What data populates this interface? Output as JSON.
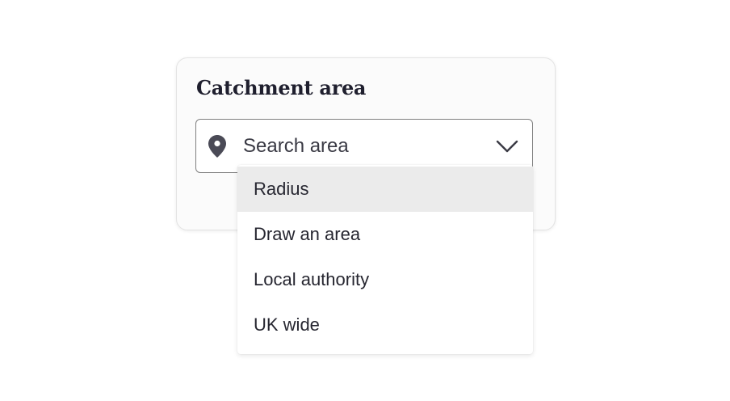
{
  "card": {
    "title": "Catchment area"
  },
  "select": {
    "icon": "map-pin-icon",
    "value": "Search area",
    "chevron_icon": "chevron-down-icon",
    "options": [
      {
        "label": "Radius",
        "highlighted": true
      },
      {
        "label": "Draw an area",
        "highlighted": false
      },
      {
        "label": "Local authority",
        "highlighted": false
      },
      {
        "label": "UK wide",
        "highlighted": false
      }
    ]
  },
  "colors": {
    "text_dark": "#1f1f2e",
    "icon": "#4a4a56",
    "highlight": "#ebebeb"
  }
}
